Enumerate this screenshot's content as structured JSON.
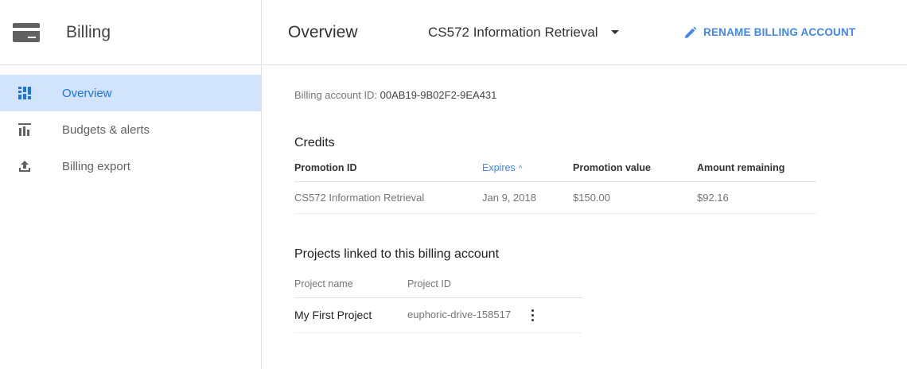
{
  "sidebar": {
    "title": "Billing",
    "items": [
      {
        "label": "Overview",
        "icon": "overview-icon",
        "active": true
      },
      {
        "label": "Budgets & alerts",
        "icon": "bar-chart-icon"
      },
      {
        "label": "Billing export",
        "icon": "upload-icon"
      }
    ]
  },
  "header": {
    "title": "Overview",
    "account_name": "CS572 Information Retrieval",
    "rename_label": "RENAME BILLING ACCOUNT"
  },
  "account": {
    "id_label": "Billing account ID: ",
    "id_value": "00AB19-9B02F2-9EA431"
  },
  "credits": {
    "title": "Credits",
    "columns": [
      "Promotion ID",
      "Expires",
      "Promotion value",
      "Amount remaining"
    ],
    "rows": [
      {
        "promotion_id": "CS572 Information Retrieval",
        "expires": "Jan 9, 2018",
        "value": "$150.00",
        "remaining": "$92.16"
      }
    ]
  },
  "projects": {
    "title": "Projects linked to this billing account",
    "columns": [
      "Project name",
      "Project ID"
    ],
    "rows": [
      {
        "name": "My First Project",
        "id": "euphoric-drive-158517"
      }
    ]
  },
  "colors": {
    "accent": "#4285f4",
    "active_bg": "#d2e3fc"
  }
}
